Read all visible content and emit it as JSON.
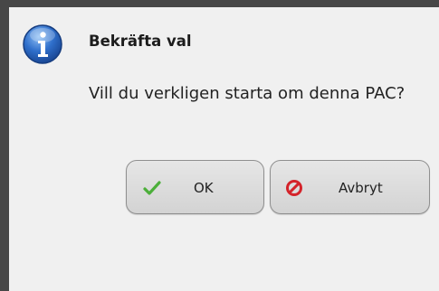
{
  "dialog": {
    "icon": "info-icon",
    "title": "Bekräfta val",
    "message": "Vill du verkligen starta om denna PAC?",
    "buttons": {
      "ok": {
        "label": "OK",
        "icon": "checkmark-icon",
        "icon_color": "#4caf3a"
      },
      "cancel": {
        "label": "Avbryt",
        "icon": "prohibited-icon",
        "icon_color": "#d4232a"
      }
    }
  },
  "colors": {
    "frame": "#474747",
    "dialog_background": "#f0f0f0",
    "info_icon_blue": "#2a63b8"
  }
}
